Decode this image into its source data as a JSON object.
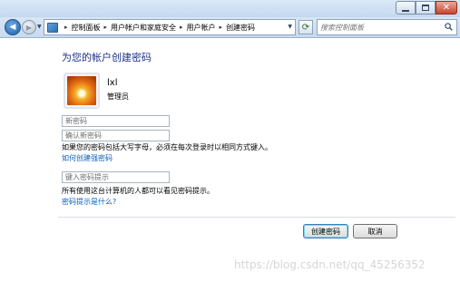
{
  "window": {
    "controls": {
      "minimize_icon": "minimize-icon",
      "maximize_icon": "maximize-icon",
      "close_icon": "close-icon",
      "close_glyph": "✕"
    }
  },
  "navbar": {
    "back_glyph": "◀",
    "forward_glyph": "▶",
    "breadcrumb": {
      "items": [
        {
          "label": "控制面板"
        },
        {
          "label": "用户帐户和家庭安全"
        },
        {
          "label": "用户帐户"
        },
        {
          "label": "创建密码"
        }
      ],
      "separator": "▸"
    },
    "refresh_glyph": "⟳",
    "search": {
      "placeholder": "搜索控制面板"
    }
  },
  "main": {
    "heading": "为您的帐户创建密码",
    "account": {
      "username": "lxl",
      "role": "管理员"
    },
    "fields": {
      "new_password": {
        "placeholder": "新密码",
        "value": ""
      },
      "confirm_password": {
        "placeholder": "确认新密码",
        "value": ""
      },
      "hint": {
        "placeholder": "键入密码提示",
        "value": ""
      }
    },
    "caps_note": "如果您的密码包括大写字母，必须在每次登录时以相同方式键入。",
    "strong_password_link": "如何创建强密码",
    "hint_note": "所有使用这台计算机的人都可以看见密码提示。",
    "hint_link": "密码提示是什么?",
    "buttons": {
      "create": "创建密码",
      "cancel": "取消"
    }
  },
  "watermark": "https://blog.csdn.net/qq_45256352",
  "colors": {
    "heading": "#1e3287",
    "link": "#0a5fbd",
    "close_button": "#c7452f"
  }
}
